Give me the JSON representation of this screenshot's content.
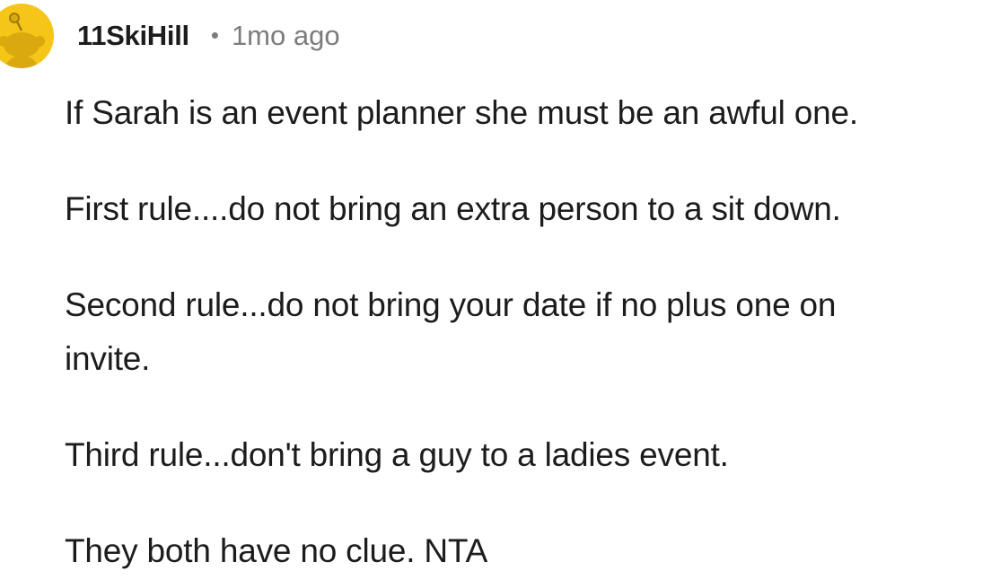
{
  "comment": {
    "avatar_icon": "reddit-snoo-avatar-icon",
    "avatar_color": "#f5c518",
    "username": "11SkiHill",
    "separator": "•",
    "timestamp": "1mo ago",
    "lines": [
      "If Sarah is an event planner she must be an awful one.",
      "First rule....do not bring an extra person to a sit down.",
      "Second rule...do not bring your date if no plus one on",
      "invite.",
      "Third rule...don't bring a guy to a ladies event.",
      "They both have no clue. NTA"
    ]
  }
}
